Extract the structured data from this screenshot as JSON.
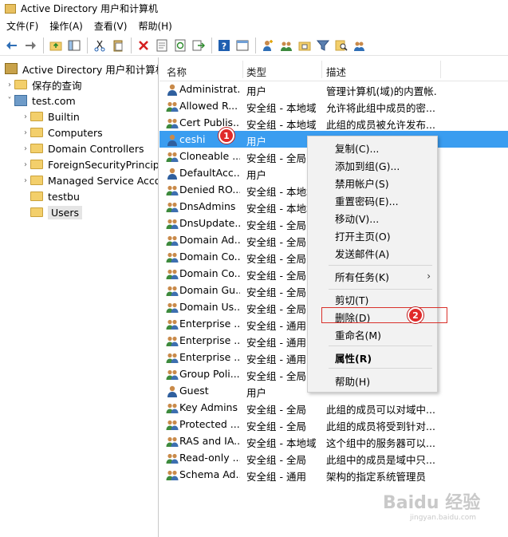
{
  "window": {
    "title": "Active Directory 用户和计算机"
  },
  "menu": [
    "文件(F)",
    "操作(A)",
    "查看(V)",
    "帮助(H)"
  ],
  "toolbar_icons": [
    "back-icon",
    "forward-icon",
    "up-folder-icon",
    "show-tree-icon",
    "cut-icon",
    "paste-icon",
    "delete-icon",
    "properties-icon",
    "refresh-icon",
    "export-icon",
    "help-icon",
    "console-icon",
    "add-user-icon",
    "add-group-icon",
    "add-ou-icon",
    "filter-icon",
    "find-icon",
    "add-to-group-icon"
  ],
  "tree": {
    "root": "Active Directory 用户和计算机",
    "items": [
      {
        "label": "保存的查询"
      },
      {
        "label": "test.com"
      },
      {
        "label": "Builtin"
      },
      {
        "label": "Computers"
      },
      {
        "label": "Domain Controllers"
      },
      {
        "label": "ForeignSecurityPrincipals"
      },
      {
        "label": "Managed Service Accounts"
      },
      {
        "label": "testbu"
      },
      {
        "label": "Users"
      }
    ]
  },
  "list": {
    "columns": [
      "名称",
      "类型",
      "描述"
    ],
    "rows": [
      {
        "name": "Administrat...",
        "type": "用户",
        "desc": "管理计算机(域)的内置帐..."
      },
      {
        "name": "Allowed R...",
        "type": "安全组 - 本地域",
        "desc": "允许将此组中成员的密..."
      },
      {
        "name": "Cert Publis...",
        "type": "安全组 - 本地域",
        "desc": "此组的成员被允许发布..."
      },
      {
        "name": "ceshi",
        "type": "用户",
        "desc": ""
      },
      {
        "name": "Cloneable ...",
        "type": "安全组 - 全局",
        "desc": ""
      },
      {
        "name": "DefaultAcc...",
        "type": "用户",
        "desc": ""
      },
      {
        "name": "Denied RO...",
        "type": "安全组 - 本地域",
        "desc": ""
      },
      {
        "name": "DnsAdmins",
        "type": "安全组 - 本地域",
        "desc": ""
      },
      {
        "name": "DnsUpdate...",
        "type": "安全组 - 全局",
        "desc": ""
      },
      {
        "name": "Domain Ad...",
        "type": "安全组 - 全局",
        "desc": ""
      },
      {
        "name": "Domain Co...",
        "type": "安全组 - 全局",
        "desc": ""
      },
      {
        "name": "Domain Co...",
        "type": "安全组 - 全局",
        "desc": ""
      },
      {
        "name": "Domain Gu...",
        "type": "安全组 - 全局",
        "desc": ""
      },
      {
        "name": "Domain Us...",
        "type": "安全组 - 全局",
        "desc": ""
      },
      {
        "name": "Enterprise ...",
        "type": "安全组 - 通用",
        "desc": ""
      },
      {
        "name": "Enterprise ...",
        "type": "安全组 - 通用",
        "desc": ""
      },
      {
        "name": "Enterprise ...",
        "type": "安全组 - 通用",
        "desc": ""
      },
      {
        "name": "Group Poli...",
        "type": "安全组 - 全局",
        "desc": ""
      },
      {
        "name": "Guest",
        "type": "用户",
        "desc": ""
      },
      {
        "name": "Key Admins",
        "type": "安全组 - 全局",
        "desc": "此组的成员可以对域中..."
      },
      {
        "name": "Protected ...",
        "type": "安全组 - 全局",
        "desc": "此组的成员将受到针对..."
      },
      {
        "name": "RAS and IA...",
        "type": "安全组 - 本地域",
        "desc": "这个组中的服务器可以..."
      },
      {
        "name": "Read-only ...",
        "type": "安全组 - 全局",
        "desc": "此组中的成员是域中只..."
      },
      {
        "name": "Schema Ad...",
        "type": "安全组 - 通用",
        "desc": "架构的指定系统管理员"
      }
    ],
    "row_kinds": [
      "user",
      "group",
      "group",
      "user",
      "group",
      "user",
      "group",
      "group",
      "group",
      "group",
      "group",
      "group",
      "group",
      "group",
      "group",
      "group",
      "group",
      "group",
      "user",
      "group",
      "group",
      "group",
      "group",
      "group"
    ]
  },
  "context_menu": {
    "items": [
      "复制(C)...",
      "添加到组(G)...",
      "禁用帐户(S)",
      "重置密码(E)...",
      "移动(V)...",
      "打开主页(O)",
      "发送邮件(A)",
      "所有任务(K)",
      "剪切(T)",
      "删除(D)",
      "重命名(M)",
      "属性(R)",
      "帮助(H)"
    ]
  },
  "annotations": {
    "badge1": "1",
    "badge2": "2"
  },
  "watermark": {
    "main": "Baidu 经验",
    "sub": "jingyan.baidu.com"
  },
  "colors": {
    "selection": "#3a9df0",
    "badge": "#e02a2a",
    "highlight_border": "#d9302a"
  }
}
